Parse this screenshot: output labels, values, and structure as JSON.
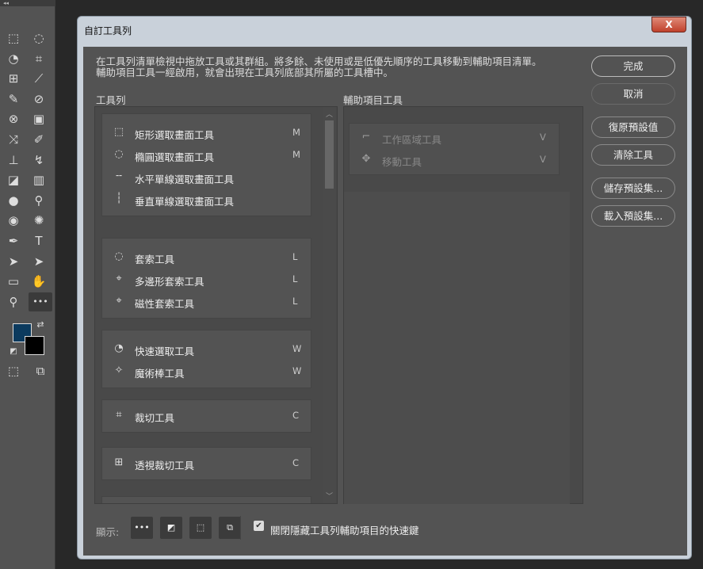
{
  "toolbar": {
    "collapse": "◂◂",
    "tools": [
      {
        "name": "rectangular-marquee",
        "glyph": "⬚"
      },
      {
        "name": "lasso",
        "glyph": "◌"
      },
      {
        "name": "quick-selection",
        "glyph": "◔"
      },
      {
        "name": "crop",
        "glyph": "⌗"
      },
      {
        "name": "perspective-crop",
        "glyph": "⊞"
      },
      {
        "name": "slice",
        "glyph": "⟋"
      },
      {
        "name": "eyedropper",
        "glyph": "✎"
      },
      {
        "name": "spot-healing",
        "glyph": "⊘"
      },
      {
        "name": "healing-brush",
        "glyph": "⊗"
      },
      {
        "name": "patch",
        "glyph": "▣"
      },
      {
        "name": "content-aware-move",
        "glyph": "⤨"
      },
      {
        "name": "brush",
        "glyph": "✐"
      },
      {
        "name": "clone-stamp",
        "glyph": "⊥"
      },
      {
        "name": "history-brush",
        "glyph": "↯"
      },
      {
        "name": "eraser",
        "glyph": "◪"
      },
      {
        "name": "gradient",
        "glyph": "▥"
      },
      {
        "name": "blur",
        "glyph": "●"
      },
      {
        "name": "dodge",
        "glyph": "⚲"
      },
      {
        "name": "smudge",
        "glyph": "◉"
      },
      {
        "name": "sponge",
        "glyph": "✺"
      },
      {
        "name": "pen",
        "glyph": "✒"
      },
      {
        "name": "type",
        "glyph": "T"
      },
      {
        "name": "path-selection",
        "glyph": "➤"
      },
      {
        "name": "direct-selection",
        "glyph": "➤"
      },
      {
        "name": "rectangle",
        "glyph": "▭"
      },
      {
        "name": "hand",
        "glyph": "✋"
      },
      {
        "name": "zoom",
        "glyph": "⚲"
      },
      {
        "name": "edit-toolbar",
        "glyph": "•••"
      }
    ],
    "foreground_color": "#0b3a5e",
    "background_color": "#000000"
  },
  "dialog": {
    "title": "自訂工具列",
    "close": "X",
    "description_line1": "在工具列清單檢視中拖放工具或其群組。將多餘、未使用或是低優先順序的工具移動到輔助項目清單。",
    "description_line2": "輔助項目工具一經啟用，就會出現在工具列底部其所屬的工具槽中。",
    "toolbar_label": "工具列",
    "extra_label": "輔助項目工具",
    "buttons": {
      "done": "完成",
      "cancel": "取消",
      "restore": "復原預設值",
      "clear": "清除工具",
      "save": "儲存預設集...",
      "load": "載入預設集..."
    },
    "groups": [
      [
        {
          "icon": "⬚",
          "name": "矩形選取畫面工具",
          "key": "M"
        },
        {
          "icon": "◌",
          "name": "橢圓選取畫面工具",
          "key": "M"
        },
        {
          "icon": "╌",
          "name": "水平單線選取畫面工具",
          "key": ""
        },
        {
          "icon": "┆",
          "name": "垂直單線選取畫面工具",
          "key": ""
        }
      ],
      [
        {
          "icon": "◌",
          "name": "套索工具",
          "key": "L"
        },
        {
          "icon": "⌖",
          "name": "多邊形套索工具",
          "key": "L"
        },
        {
          "icon": "⌖",
          "name": "磁性套索工具",
          "key": "L"
        }
      ],
      [
        {
          "icon": "◔",
          "name": "快速選取工具",
          "key": "W"
        },
        {
          "icon": "✧",
          "name": "魔術棒工具",
          "key": "W"
        }
      ],
      [
        {
          "icon": "⌗",
          "name": "裁切工具",
          "key": "C"
        }
      ],
      [
        {
          "icon": "⊞",
          "name": "透視裁切工具",
          "key": "C"
        }
      ]
    ],
    "extras": [
      {
        "icon": "⌐",
        "name": "工作區域工具",
        "key": "V"
      },
      {
        "icon": "✥",
        "name": "移動工具",
        "key": "V"
      }
    ],
    "footer": {
      "show_label": "顯示:",
      "icons": [
        "•••",
        "◩",
        "⬚",
        "⧉"
      ],
      "checkbox_checked": true,
      "checkbox_label": "關閉隱藏工具列輔助項目的快速鍵"
    }
  }
}
